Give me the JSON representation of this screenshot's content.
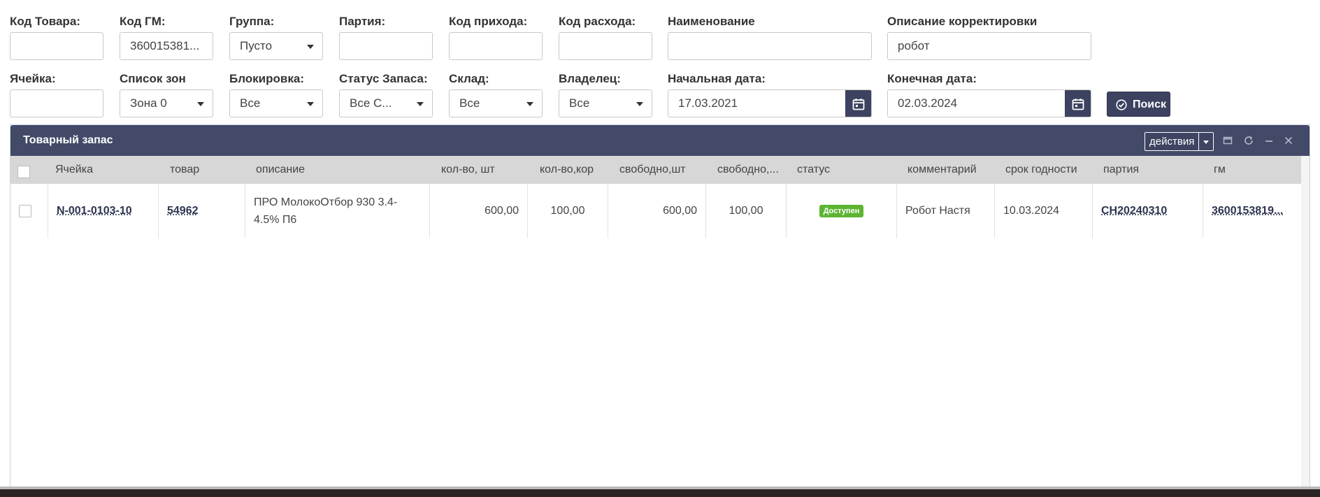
{
  "filters": {
    "product_code": {
      "label": "Код Товара:",
      "value": ""
    },
    "gm_code": {
      "label": "Код ГМ:",
      "value": "360015381..."
    },
    "group": {
      "label": "Группа:",
      "value": "Пусто"
    },
    "batch": {
      "label": "Партия:",
      "value": ""
    },
    "income_code": {
      "label": "Код прихода:",
      "value": ""
    },
    "expense_code": {
      "label": "Код расхода:",
      "value": ""
    },
    "name": {
      "label": "Наименование",
      "value": ""
    },
    "correction_desc": {
      "label": "Описание корректировки",
      "value": "робот"
    },
    "cell": {
      "label": "Ячейка:",
      "value": ""
    },
    "zones": {
      "label": "Список зон",
      "value": "Зона 0"
    },
    "blocking": {
      "label": "Блокировка:",
      "value": "Все"
    },
    "stock_status": {
      "label": "Статус Запаса:",
      "value": "Все С..."
    },
    "warehouse": {
      "label": "Склад:",
      "value": "Все"
    },
    "owner": {
      "label": "Владелец:",
      "value": "Все"
    },
    "start_date": {
      "label": "Начальная дата:",
      "value": "17.03.2021"
    },
    "end_date": {
      "label": "Конечная дата:",
      "value": "02.03.2024"
    },
    "search_label": "Поиск"
  },
  "panel": {
    "title": "Товарный запас",
    "actions_label": "действия"
  },
  "table": {
    "columns": [
      "Ячейка",
      "товар",
      "описание",
      "кол-во, шт",
      "кол-во,кор",
      "свободно,шт",
      "свободно,...",
      "статус",
      "комментарий",
      "срок годности",
      "партия",
      "гм"
    ],
    "rows": [
      {
        "cell": "N-001-0103-10",
        "product": "54962",
        "description": "ПРО МолокоОтбор 930 3.4-4.5% П6",
        "qty_pcs": "600,00",
        "qty_box": "100,00",
        "free_pcs": "600,00",
        "free_box": "100,00",
        "status": "Доступен",
        "comment": "Робот Настя",
        "expiry": "10.03.2024",
        "batch": "CH20240310",
        "gm": "3600153819..."
      }
    ]
  },
  "colors": {
    "header_bg": "#434a68",
    "button_bg": "#3c4260",
    "status_green": "#5cb531",
    "grid_header_bg": "#d7d7d7"
  }
}
